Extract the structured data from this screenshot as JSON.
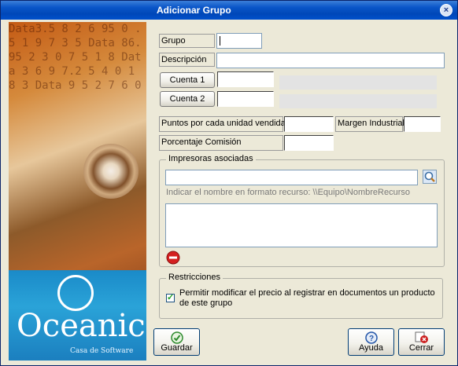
{
  "window": {
    "title": "Adicionar Grupo",
    "close_glyph": "×"
  },
  "branding": {
    "logo_text": "Oceanic",
    "logo_sub": "Casa de Software",
    "background_digits": "Data3.5 8 2 6 95 0 .5 1 9 7 3 5 Data 86.95 2 3 0 7 5 1 8 Data 3 6 9 7.2 5 4 0 1 8 3 Data 9 5 2 7 6 0"
  },
  "form": {
    "grupo_label": "Grupo",
    "grupo_value": "",
    "descripcion_label": "Descripción",
    "descripcion_value": "",
    "cuenta1_label": "Cuenta 1",
    "cuenta1_value": "",
    "cuenta2_label": "Cuenta 2",
    "cuenta2_value": "",
    "puntos_label": "Puntos por cada unidad vendida",
    "puntos_value": "",
    "margen_label": "Margen Industrial",
    "margen_value": "",
    "porcentaje_label": "Porcentaje Comisión",
    "porcentaje_value": ""
  },
  "impresoras": {
    "title": "Impresoras asociadas",
    "search_value": "",
    "hint": "Indicar el nombre en formato recurso: \\\\Equipo\\NombreRecurso",
    "items": []
  },
  "restricciones": {
    "title": "Restricciones",
    "checkbox_label": "Permitir modificar el precio al registrar en documentos un producto de este grupo",
    "checked": true
  },
  "buttons": {
    "guardar": "Guardar",
    "ayuda": "Ayuda",
    "cerrar": "Cerrar"
  },
  "colors": {
    "titlebar": "#0050cc",
    "accent_ok": "#2e8b2e",
    "accent_close": "#cc2020"
  },
  "icons": {
    "search": "magnifier-icon",
    "remove": "no-entry-icon",
    "save": "check-circle-icon",
    "help": "question-icon",
    "close": "close-x-icon"
  }
}
